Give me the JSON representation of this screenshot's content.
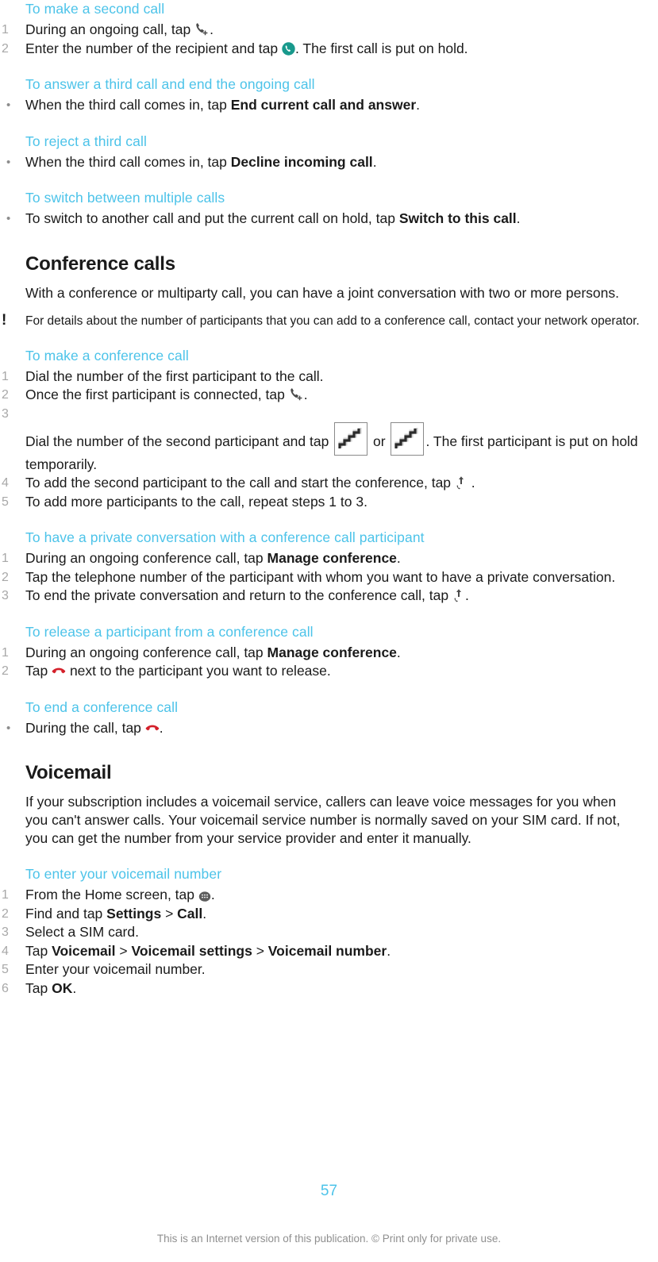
{
  "document": {
    "page_number": "57",
    "footer_note": "This is an Internet version of this publication. © Print only for private use.",
    "accent_color": "#4cc3e9",
    "body_color": "#1a1a1a",
    "marker_color": "#a8a8a8"
  },
  "blocks": {
    "make_second_call": {
      "heading": "To make a second call",
      "steps": [
        {
          "marker": "1",
          "pre": "During an ongoing call, tap ",
          "icon": "add-call-icon",
          "post": "."
        },
        {
          "marker": "2",
          "pre": "Enter the number of the recipient and tap ",
          "icon": "call-button-icon",
          "post": ". The first call is put on hold."
        }
      ]
    },
    "answer_third_call": {
      "heading": "To answer a third call and end the ongoing call",
      "steps": [
        {
          "marker": "•",
          "pre": "When the third call comes in, tap ",
          "bold": "End current call and answer",
          "post": "."
        }
      ]
    },
    "reject_third_call": {
      "heading": "To reject a third call",
      "steps": [
        {
          "marker": "•",
          "pre": "When the third call comes in, tap ",
          "bold": "Decline incoming call",
          "post": "."
        }
      ]
    },
    "switch_calls": {
      "heading": "To switch between multiple calls",
      "steps": [
        {
          "marker": "•",
          "pre": "To switch to another call and put the current call on hold, tap ",
          "bold": "Switch to this call",
          "post": "."
        }
      ]
    },
    "conference_calls": {
      "heading": "Conference calls",
      "intro": "With a conference or multiparty call, you can have a joint conversation with two or more persons.",
      "note_marker": "!",
      "note": "For details about the number of participants that you can add to a conference call, contact your network operator."
    },
    "make_conference_call": {
      "heading": "To make a conference call",
      "steps": [
        {
          "marker": "1",
          "text": "Dial the number of the first participant to the call."
        },
        {
          "marker": "2",
          "pre": "Once the first participant is connected, tap ",
          "icon": "add-call-icon",
          "post": "."
        },
        {
          "marker": "3",
          "pre": "Dial the number of the second participant and tap ",
          "mid": " or ",
          "post": ". The first participant is put on hold temporarily.",
          "placeholder_count": 2
        },
        {
          "marker": "4",
          "pre": "To add the second participant to the call and start the conference, tap ",
          "icon": "merge-call-icon",
          "post": " ."
        },
        {
          "marker": "5",
          "text": "To add more participants to the call, repeat steps 1 to 3."
        }
      ]
    },
    "private_conversation": {
      "heading": "To have a private conversation with a conference call participant",
      "steps": [
        {
          "marker": "1",
          "pre": "During an ongoing conference call, tap ",
          "bold": "Manage conference",
          "post": "."
        },
        {
          "marker": "2",
          "text": "Tap the telephone number of the participant with whom you want to have a private conversation."
        },
        {
          "marker": "3",
          "pre": "To end the private conversation and return to the conference call, tap ",
          "icon": "merge-call-icon",
          "post": "."
        }
      ]
    },
    "release_participant": {
      "heading": "To release a participant from a conference call",
      "steps": [
        {
          "marker": "1",
          "pre": "During an ongoing conference call, tap ",
          "bold": "Manage conference",
          "post": "."
        },
        {
          "marker": "2",
          "pre": "Tap ",
          "icon": "end-call-icon",
          "post": " next to the participant you want to release."
        }
      ]
    },
    "end_conference_call": {
      "heading": "To end a conference call",
      "steps": [
        {
          "marker": "•",
          "pre": "During the call, tap ",
          "icon": "end-call-icon",
          "post": "."
        }
      ]
    },
    "voicemail": {
      "heading": "Voicemail",
      "intro": "If your subscription includes a voicemail service, callers can leave voice messages for you when you can't answer calls. Your voicemail service number is normally saved on your SIM card. If not, you can get the number from your service provider and enter it manually."
    },
    "enter_voicemail_number": {
      "heading": "To enter your voicemail number",
      "steps": [
        {
          "marker": "1",
          "pre": "From the Home screen, tap ",
          "icon": "app-drawer-icon",
          "post": "."
        },
        {
          "marker": "2",
          "pre": "Find and tap ",
          "bold": "Settings",
          "sep": " > ",
          "bold2": "Call",
          "post": "."
        },
        {
          "marker": "3",
          "text": "Select a SIM card."
        },
        {
          "marker": "4",
          "pre": "Tap ",
          "bold": "Voicemail",
          "sep": " > ",
          "bold2": "Voicemail settings",
          "sep2": " > ",
          "bold3": "Voicemail number",
          "post": "."
        },
        {
          "marker": "5",
          "text": "Enter your voicemail number."
        },
        {
          "marker": "6",
          "pre": "Tap ",
          "bold": "OK",
          "post": "."
        }
      ]
    }
  },
  "icons": {
    "add_call": "add-call-icon",
    "call_button": "call-button-icon",
    "merge_call": "merge-call-icon",
    "end_call": "end-call-icon",
    "app_drawer": "app-drawer-icon",
    "image_placeholder": "broken-image-placeholder-icon",
    "note_exclamation": "exclamation-note-icon"
  }
}
